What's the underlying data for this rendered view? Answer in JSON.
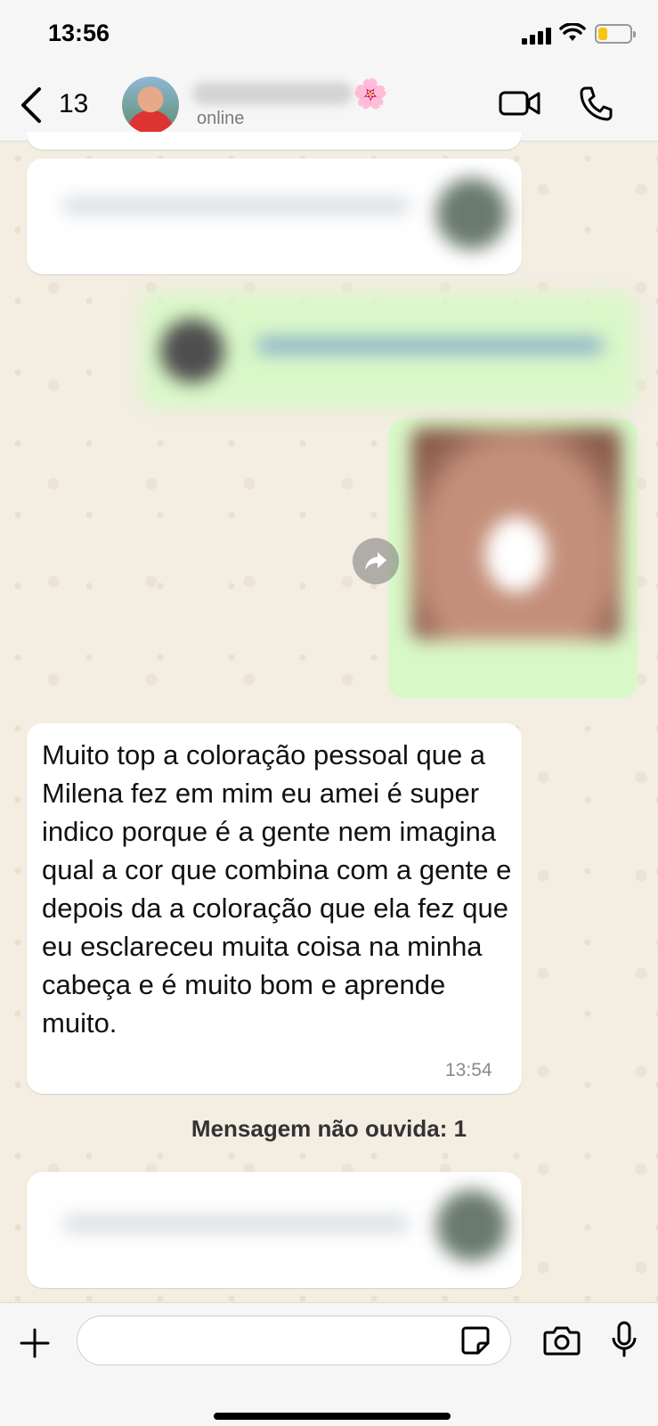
{
  "status_bar": {
    "time": "13:56"
  },
  "header": {
    "back_count": "13",
    "contact_status": "online",
    "contact_emoji": "🌸"
  },
  "messages": {
    "incoming_text": "Muito top a coloração pessoal que a Milena fez em mim eu amei é super indico porque é a gente nem imagina qual a cor que combina com a gente e depois da a coloração que ela fez que eu esclareceu muita coisa na minha cabeça e é muito bom e aprende muito.",
    "incoming_time": "13:54"
  },
  "unread_banner": "Mensagem não ouvida: 1",
  "composer": {
    "value": "",
    "placeholder": ""
  },
  "colors": {
    "outgoing_bubble": "#d9f8c8",
    "incoming_bubble": "#ffffff",
    "wallpaper": "#f3ede2"
  }
}
